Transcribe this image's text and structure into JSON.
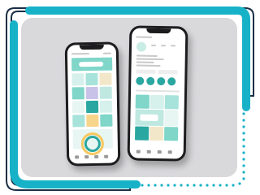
{
  "colors": {
    "frame_teal": "#17b2c8",
    "frame_navy": "#1b2f45",
    "backdrop": "#d9d9dc",
    "phone_body": "#1c1c1e",
    "accent_mint": "#7fd6c9",
    "accent_teal": "#2aa7a0"
  },
  "icons": {
    "dotted_trail": "dot-trail",
    "phone_notch": "notch"
  }
}
